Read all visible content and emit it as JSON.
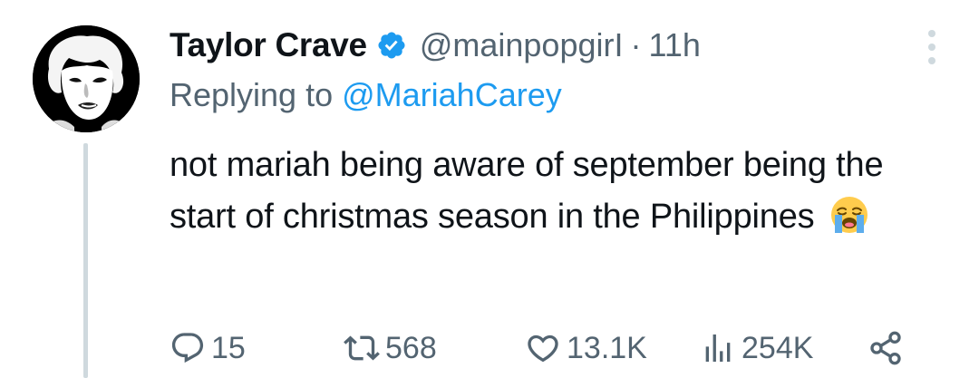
{
  "tweet": {
    "display_name": "Taylor Crave",
    "handle": "@mainpopgirI",
    "separator": "·",
    "time": "11h",
    "replying_prefix": "Replying to ",
    "replying_to": "@MariahCarey",
    "text": "not mariah being aware of september being the start of christmas season in the Philippines",
    "emoji": "loudly-crying-face"
  },
  "actions": {
    "replies": "15",
    "retweets": "568",
    "likes": "13.1K",
    "views": "254K"
  },
  "icons": {
    "verified": "verified-badge-icon",
    "more": "more-options-icon",
    "reply": "reply-icon",
    "retweet": "retweet-icon",
    "like": "heart-icon",
    "views": "views-icon",
    "share": "share-icon"
  },
  "colors": {
    "accent": "#1d9bf0",
    "secondary_text": "#536471",
    "primary_text": "#0f1419",
    "thread_line": "#cfd9de"
  }
}
